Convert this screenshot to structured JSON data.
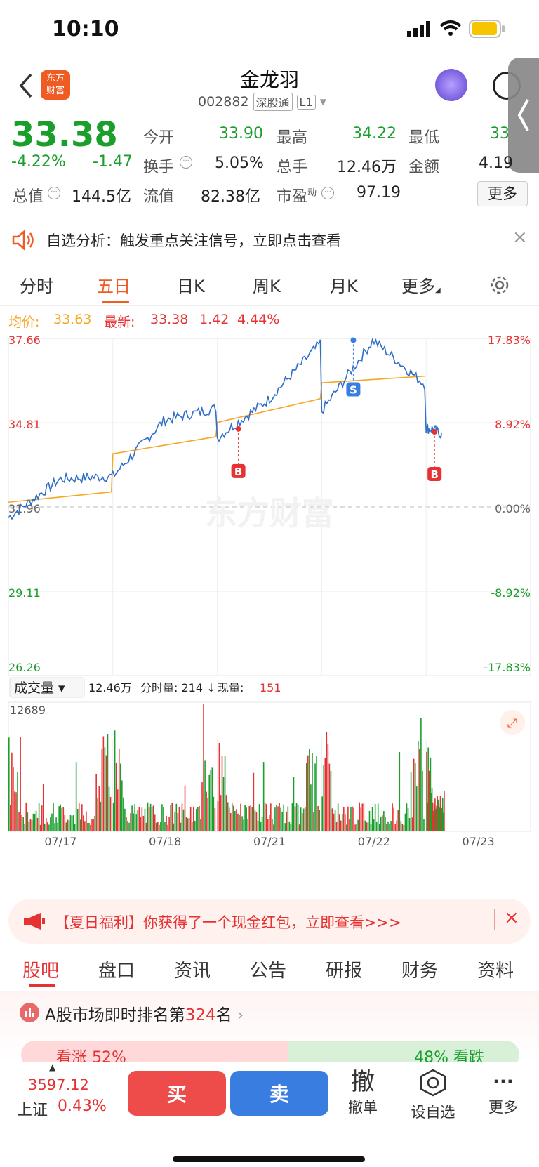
{
  "status": {
    "time": "10:10"
  },
  "nav": {
    "logo_line1": "东方",
    "logo_line2": "财富",
    "title": "金龙羽",
    "code": "002882",
    "market_tag": "深股通",
    "level_tag": "L1"
  },
  "quote": {
    "price": "33.38",
    "change_pct": "-4.22%",
    "change": "-1.47",
    "open_label": "今开",
    "open": "33.90",
    "high_label": "最高",
    "high": "34.22",
    "low_label": "最低",
    "low": "33",
    "turnover_label": "换手",
    "turnover": "5.05%",
    "volume_label": "总手",
    "volume": "12.46万",
    "amount_label": "金额",
    "amount": "4.19",
    "mktcap_label": "总值",
    "mktcap": "144.5亿",
    "float_label": "流值",
    "float": "82.38亿",
    "pe_label": "市盈",
    "pe_sup": "动",
    "pe": "97.19",
    "more": "更多"
  },
  "banner": {
    "text": "自选分析：触发重点关注信号，立即点击查看"
  },
  "tabs": [
    "分时",
    "五日",
    "日K",
    "周K",
    "月K",
    "更多"
  ],
  "active_tab": 1,
  "legend": {
    "avg_label": "均价:",
    "avg": "33.63",
    "latest_label": "最新:",
    "latest": "33.38",
    "chg": "1.42",
    "pct": "4.44%"
  },
  "chart_data": {
    "type": "line",
    "y_left": [
      "37.66",
      "34.81",
      "31.96",
      "29.11",
      "26.26"
    ],
    "y_right": [
      "17.83%",
      "8.92%",
      "0.00%",
      "-8.92%",
      "-17.83%"
    ],
    "x": [
      "07/17",
      "07/18",
      "07/21",
      "07/22",
      "07/23"
    ],
    "ylim": [
      26.26,
      37.66
    ],
    "series": [
      {
        "name": "price",
        "color": "#2f6ec8"
      },
      {
        "name": "均价",
        "color": "#f5a623"
      }
    ],
    "marks": [
      "B",
      "S",
      "B"
    ],
    "watermark": "东方财富",
    "volume_label": "成交量",
    "volume_total": "12.46万",
    "tick_vol_label": "分时量:",
    "tick_vol": "214",
    "cur_vol_label": "现量:",
    "cur_vol": "151",
    "volume_max": "12689"
  },
  "promo": {
    "text": "【夏日福利】你获得了一个现金红包，立即查看>>>"
  },
  "subtabs": [
    "股吧",
    "盘口",
    "资讯",
    "公告",
    "研报",
    "财务",
    "资料"
  ],
  "rank": {
    "prefix": "A股市场即时排名第",
    "num": "324",
    "suffix": "名",
    "up_text": "看涨 52%",
    "down_text": "48% 看跌"
  },
  "bottom": {
    "index_value": "3597.12",
    "index_name": "上证",
    "index_pct": "0.43%",
    "buy": "买",
    "sell": "卖",
    "cancel_big": "撤",
    "cancel": "撤单",
    "watch": "设自选",
    "more": "更多"
  }
}
